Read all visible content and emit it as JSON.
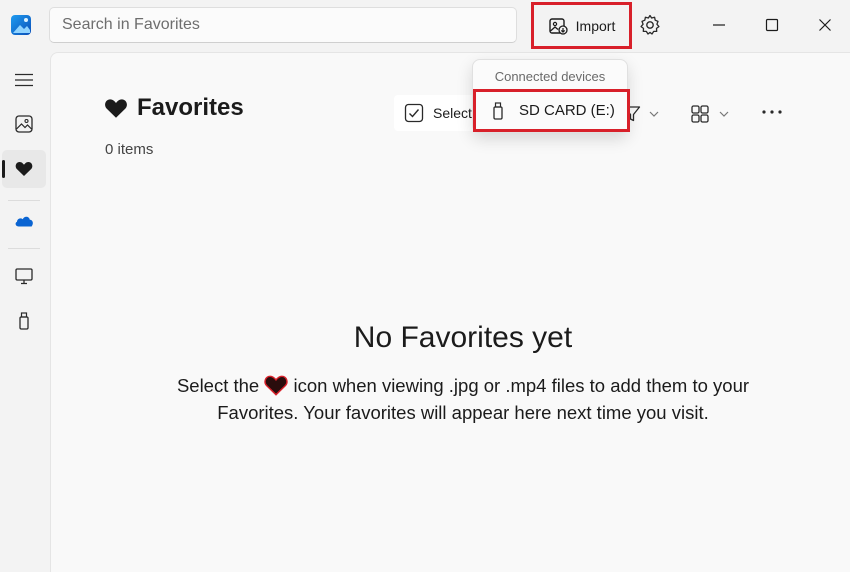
{
  "search": {
    "placeholder": "Search in Favorites"
  },
  "toolbar": {
    "import_label": "Import"
  },
  "page": {
    "title": "Favorites",
    "item_count": "0 items"
  },
  "actions": {
    "select_label": "Select"
  },
  "dropdown": {
    "header": "Connected devices",
    "device_label": "SD CARD (E:)"
  },
  "empty_state": {
    "title": "No Favorites yet",
    "text_before": "Select the ",
    "text_after": " icon when viewing .jpg or .mp4 files to add them to your Favorites. Your favorites will appear here next time you visit."
  },
  "sidebar": {
    "items": [
      "hamburger-icon",
      "gallery-icon",
      "heart-icon",
      "onedrive-icon",
      "this-pc-icon",
      "usb-drive-icon"
    ],
    "active": "heart-icon"
  },
  "colors": {
    "highlight": "#d8202a",
    "accent": "#0a64d2"
  }
}
